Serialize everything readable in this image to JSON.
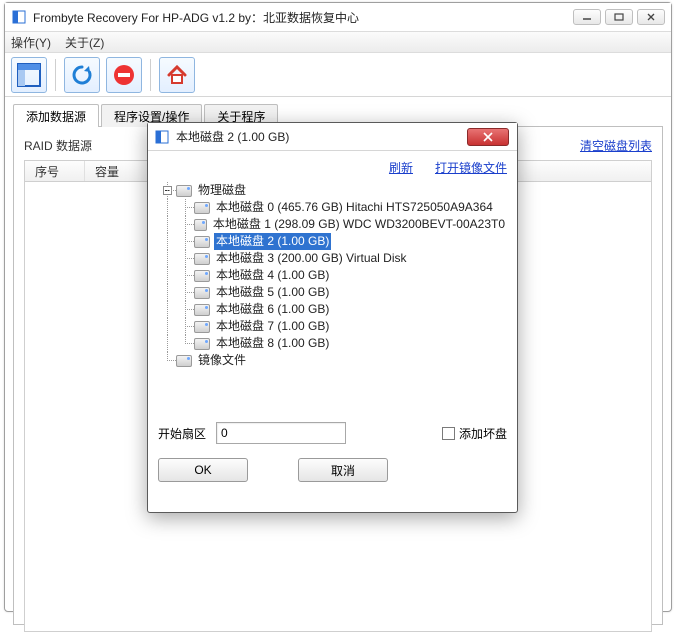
{
  "window": {
    "title": "Frombyte Recovery For HP-ADG v1.2 by：北亚数据恢复中心",
    "menu": {
      "action": "操作(Y)",
      "about": "关于(Z)"
    }
  },
  "tabs": {
    "add": "添加数据源",
    "settings": "程序设置/操作",
    "about": "关于程序"
  },
  "pane": {
    "header": "RAID 数据源",
    "clear_link": "清空磁盘列表",
    "cols": {
      "num": "序号",
      "size": "容量"
    }
  },
  "dialog": {
    "title": "本地磁盘 2  (1.00 GB)",
    "refresh": "刷新",
    "open_image": "打开镜像文件",
    "tree": {
      "physical": "物理磁盘",
      "disks": [
        "本地磁盘 0  (465.76 GB) Hitachi HTS725050A9A364",
        "本地磁盘 1  (298.09 GB) WDC WD3200BEVT-00A23T0",
        "本地磁盘 2  (1.00 GB)",
        "本地磁盘 3  (200.00 GB) Virtual Disk",
        "本地磁盘 4  (1.00 GB)",
        "本地磁盘 5  (1.00 GB)",
        "本地磁盘 6  (1.00 GB)",
        "本地磁盘 7  (1.00 GB)",
        "本地磁盘 8  (1.00 GB)"
      ],
      "image": "镜像文件"
    },
    "start_sector_label": "开始扇区",
    "start_sector_value": "0",
    "add_bad_label": "添加坏盘",
    "ok": "OK",
    "cancel": "取消"
  }
}
